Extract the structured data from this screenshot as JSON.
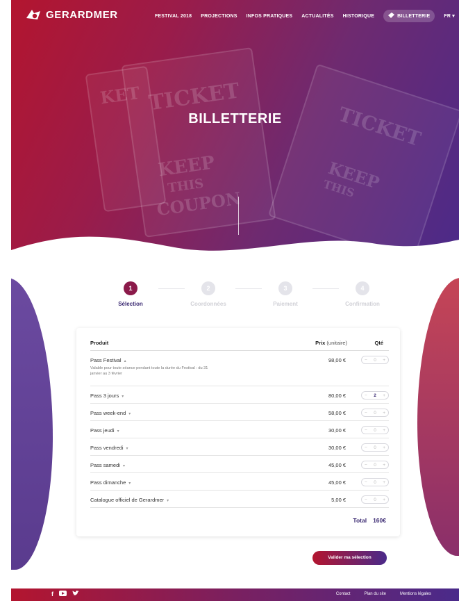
{
  "brand": {
    "name": "GERARDMER"
  },
  "nav": {
    "items": [
      "FESTIVAL 2018",
      "PROJECTIONS",
      "INFOS PRATIQUES",
      "ACTUALITÉS",
      "HISTORIQUE"
    ],
    "ticket_label": "BILLETTERIE",
    "lang": "FR"
  },
  "hero": {
    "title": "BILLETTERIE"
  },
  "steps": [
    {
      "number": "1",
      "label": "Sélection",
      "active": true
    },
    {
      "number": "2",
      "label": "Coordonnées",
      "active": false
    },
    {
      "number": "3",
      "label": "Paiement",
      "active": false
    },
    {
      "number": "4",
      "label": "Confirmation",
      "active": false
    }
  ],
  "table": {
    "headers": {
      "product": "Produit",
      "price": "Prix",
      "price_unit": "(unitaire)",
      "qty": "Qté"
    },
    "rows": [
      {
        "name": "Pass Festival",
        "description": "Valable pour toute séance pendant toute la durée du Festival : du 31 janvier au 3 février",
        "price": "98,00 €",
        "qty": "0"
      },
      {
        "name": "Pass 3 jours",
        "price": "80,00 €",
        "qty": "2"
      },
      {
        "name": "Pass week-end",
        "price": "58,00 €",
        "qty": "0"
      },
      {
        "name": "Pass jeudi",
        "price": "30,00 €",
        "qty": "0"
      },
      {
        "name": "Pass vendredi",
        "price": "30,00 €",
        "qty": "0"
      },
      {
        "name": "Pass samedi",
        "price": "45,00 €",
        "qty": "0"
      },
      {
        "name": "Pass dimanche",
        "price": "45,00 €",
        "qty": "0"
      },
      {
        "name": "Catalogue officiel de Gerardmer",
        "price": "5,00 €",
        "qty": "0"
      }
    ],
    "total_label": "Total",
    "total_value": "160€"
  },
  "submit_label": "Valider ma sélection",
  "footer": {
    "social": [
      "f",
      "▶",
      "🐦"
    ],
    "links": [
      "Contact",
      "Plan du site",
      "Mentions légales"
    ]
  },
  "colors": {
    "primary_red": "#b3152f",
    "primary_purple": "#4a2a8a",
    "accent": "#8b1a4a"
  }
}
